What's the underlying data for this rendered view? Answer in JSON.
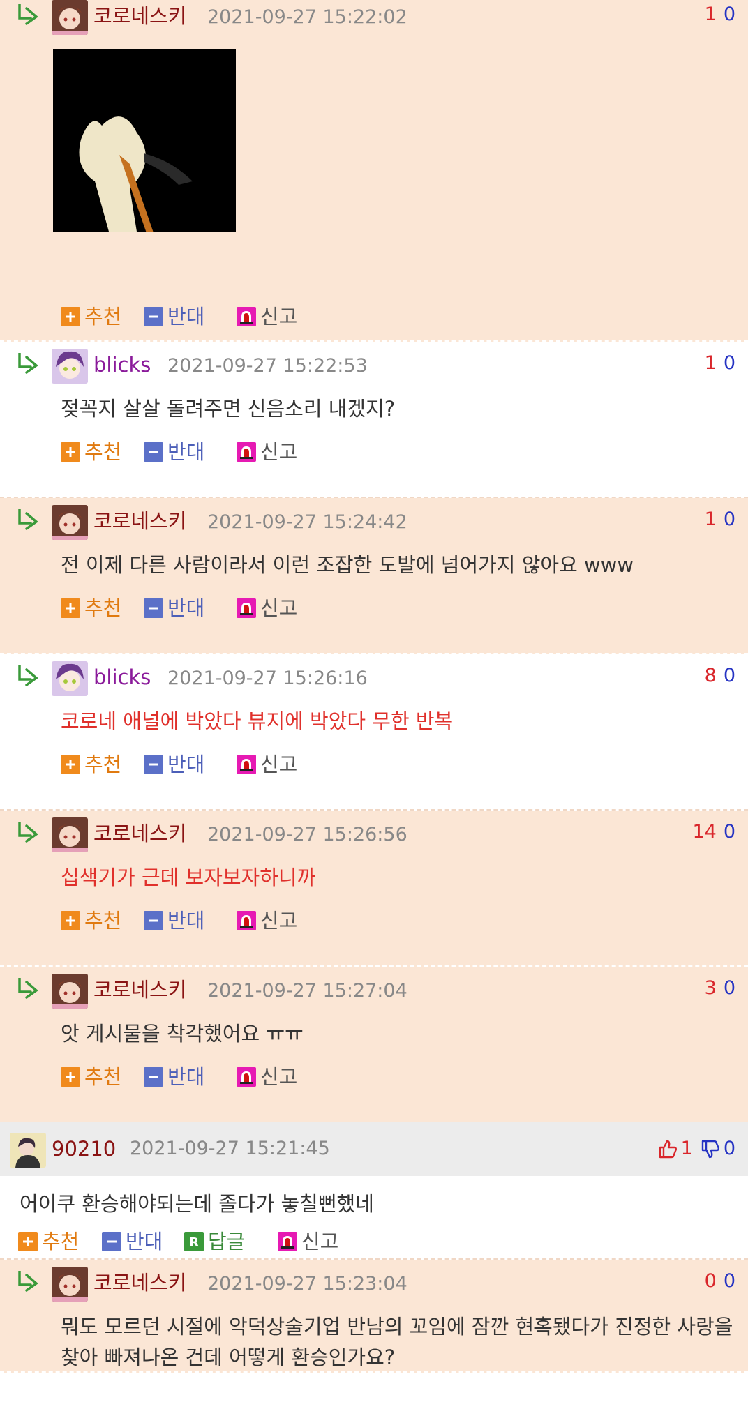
{
  "buttons": {
    "recommend": "추천",
    "oppose": "반대",
    "reply": "답글",
    "report": "신고"
  },
  "replies": [
    {
      "user": "코로네스키",
      "time": "2021-09-27 15:22:02",
      "up": "1",
      "down": "0",
      "text": ""
    },
    {
      "user": "blicks",
      "time": "2021-09-27 15:22:53",
      "up": "1",
      "down": "0",
      "text": "젖꼭지 살살 돌려주면 신음소리 내겠지?"
    },
    {
      "user": "코로네스키",
      "time": "2021-09-27 15:24:42",
      "up": "1",
      "down": "0",
      "text": "전 이제 다른 사람이라서 이런 조잡한 도발에 넘어가지 않아요 www"
    },
    {
      "user": "blicks",
      "time": "2021-09-27 15:26:16",
      "up": "8",
      "down": "0",
      "text": "코로네 애널에 박았다 뷰지에 박았다 무한 반복"
    },
    {
      "user": "코로네스키",
      "time": "2021-09-27 15:26:56",
      "up": "14",
      "down": "0",
      "text": "십색기가 근데 보자보자하니까"
    },
    {
      "user": "코로네스키",
      "time": "2021-09-27 15:27:04",
      "up": "3",
      "down": "0",
      "text": "앗 게시물을 착각했어요 ㅠㅠ"
    }
  ],
  "comment": {
    "user": "90210",
    "time": "2021-09-27 15:21:45",
    "up": "1",
    "down": "0",
    "text": "어이쿠 환승해야되는데 졸다가 놓칠뻔했네"
  },
  "last_reply": {
    "user": "코로네스키",
    "time": "2021-09-27 15:23:04",
    "up": "0",
    "down": "0",
    "text": "뭐도 모르던 시절에 악덕상술기업 반남의 꼬임에 잠깐 현혹됐다가 진정한 사랑을 찾아 빠져나온 건데 어떻게 환승인가요?"
  },
  "colors": {
    "reply_bg": "#fbe6d5",
    "comment_head_bg": "#ececec",
    "user_korone": "#8a1414",
    "user_blicks": "#8a1a9a",
    "up": "#d9262b",
    "down": "#2533c3"
  },
  "icons": {
    "reply_arrow": "reply-arrow-icon",
    "thumb_up": "thumb-up-icon",
    "thumb_down": "thumb-down-icon"
  }
}
